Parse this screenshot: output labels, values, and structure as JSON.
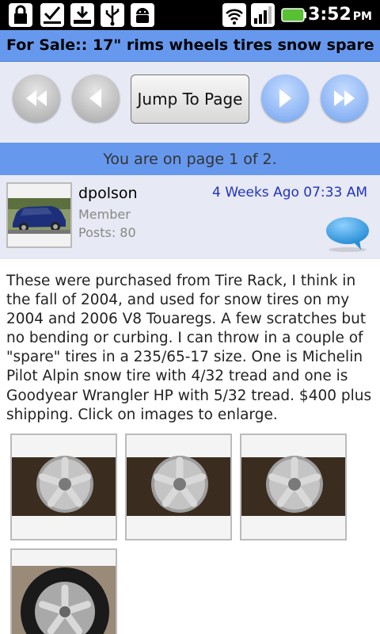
{
  "status_bar": {
    "time": "3:52",
    "ampm": "PM",
    "icons": [
      "lock-icon",
      "task-check-icon",
      "download-icon",
      "usb-icon",
      "android-debug-icon",
      "wifi-icon",
      "signal-icon",
      "battery-icon"
    ]
  },
  "thread": {
    "title": "For Sale:: 17\" rims wheels tires snow spare"
  },
  "pager": {
    "jump_label": "Jump To Page",
    "page_status": "You are on page 1 of 2."
  },
  "post": {
    "username": "dpolson",
    "role": "Member",
    "posts": "Posts: 80",
    "date": "4 Weeks Ago 07:33 AM",
    "body": "These were purchased from Tire Rack, I think in the fall of 2004, and used for snow tires on my 2004 and 2006 V8 Touaregs. A few scratches but no bending or curbing. I can throw in a couple of \"spare\" tires in a 235/65-17 size. One is Michelin Pilot Alpin snow tire with 4/32 tread and one is Goodyear Wrangler HP with 5/32 tread. $400 plus shipping. Click on images to enlarge.",
    "image_count": 4
  },
  "colors": {
    "title_bar": "#6699ee",
    "panel_bg": "#e7e9f4",
    "date_text": "#2233bb"
  }
}
